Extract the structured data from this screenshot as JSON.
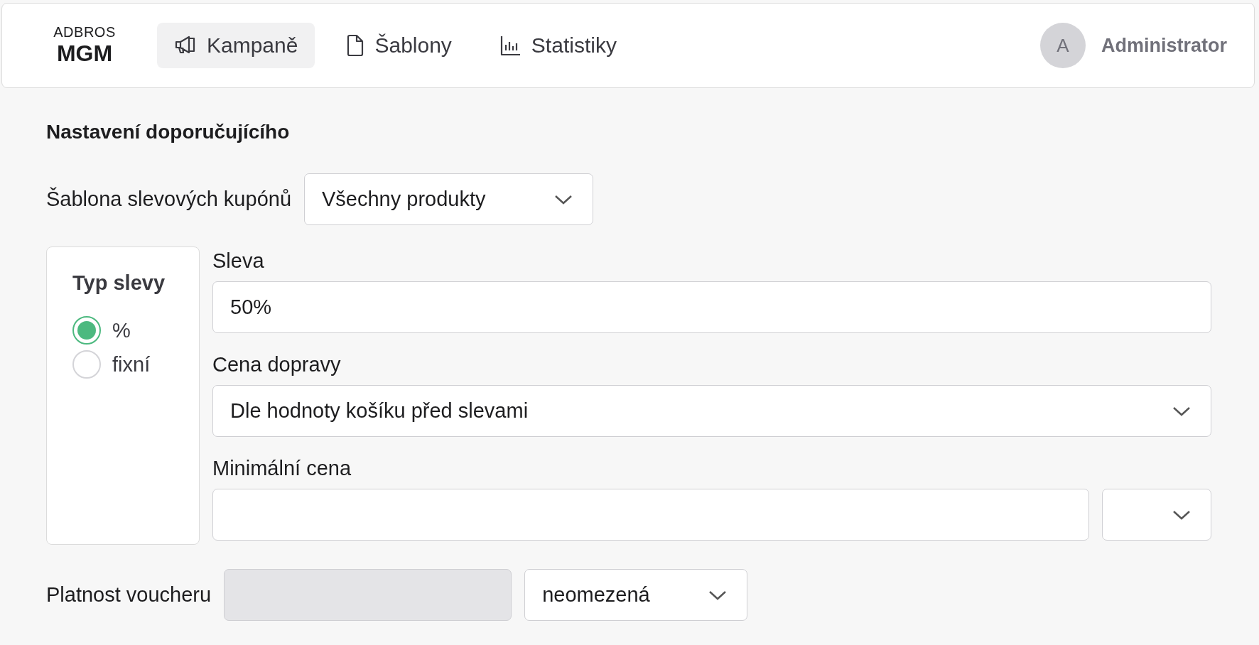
{
  "logo": {
    "top": "ADBROS",
    "bottom": "MGM"
  },
  "nav": [
    {
      "label": "Kampaně",
      "selected": true
    },
    {
      "label": "Šablony",
      "selected": false
    },
    {
      "label": "Statistiky",
      "selected": false
    }
  ],
  "user": {
    "initial": "A",
    "name": "Administrator"
  },
  "section_title": "Nastavení doporučujícího",
  "template": {
    "label": "Šablona slevových kupónů",
    "value": "Všechny produkty"
  },
  "discount_type": {
    "title": "Typ slevy",
    "options": [
      {
        "label": "%",
        "selected": true
      },
      {
        "label": "fixní",
        "selected": false
      }
    ]
  },
  "discount": {
    "label": "Sleva",
    "value": "50%"
  },
  "shipping": {
    "label": "Cena dopravy",
    "value": "Dle hodnoty košíku před slevami"
  },
  "min_price": {
    "label": "Minimální cena"
  },
  "validity": {
    "label": "Platnost voucheru",
    "disabled": true,
    "value": "neomezená"
  }
}
